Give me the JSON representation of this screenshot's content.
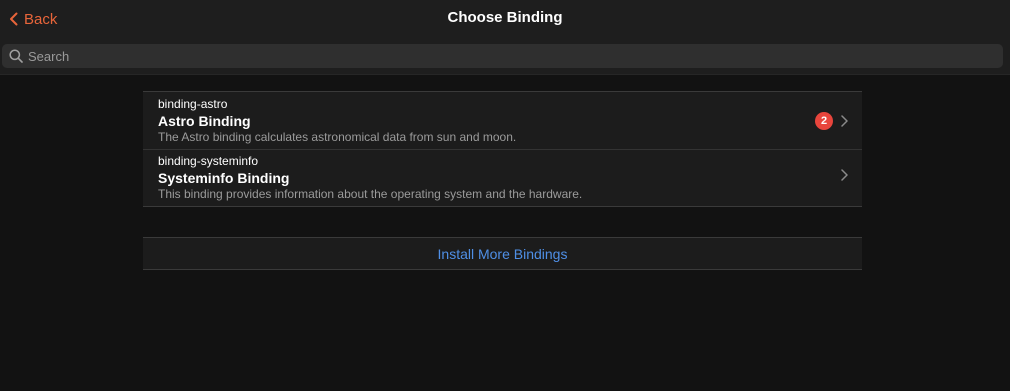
{
  "navbar": {
    "back_label": "Back",
    "title": "Choose Binding"
  },
  "search": {
    "placeholder": "Search",
    "value": ""
  },
  "bindings": [
    {
      "id": "binding-astro",
      "title": "Astro Binding",
      "description": "The Astro binding calculates astronomical data from sun and moon.",
      "badge": "2"
    },
    {
      "id": "binding-systeminfo",
      "title": "Systeminfo Binding",
      "description": "This binding provides information about the operating system and the hardware."
    }
  ],
  "install_more": {
    "label": "Install More Bindings"
  },
  "icons": {
    "back": "chevron-left-icon",
    "search": "search-icon",
    "item_chevron": "chevron-right-icon"
  },
  "colors": {
    "accent": "#e8653a",
    "link": "#4f8fe6",
    "badge": "#e8453c",
    "background": "#121212",
    "navbar": "#1e1e1e"
  }
}
